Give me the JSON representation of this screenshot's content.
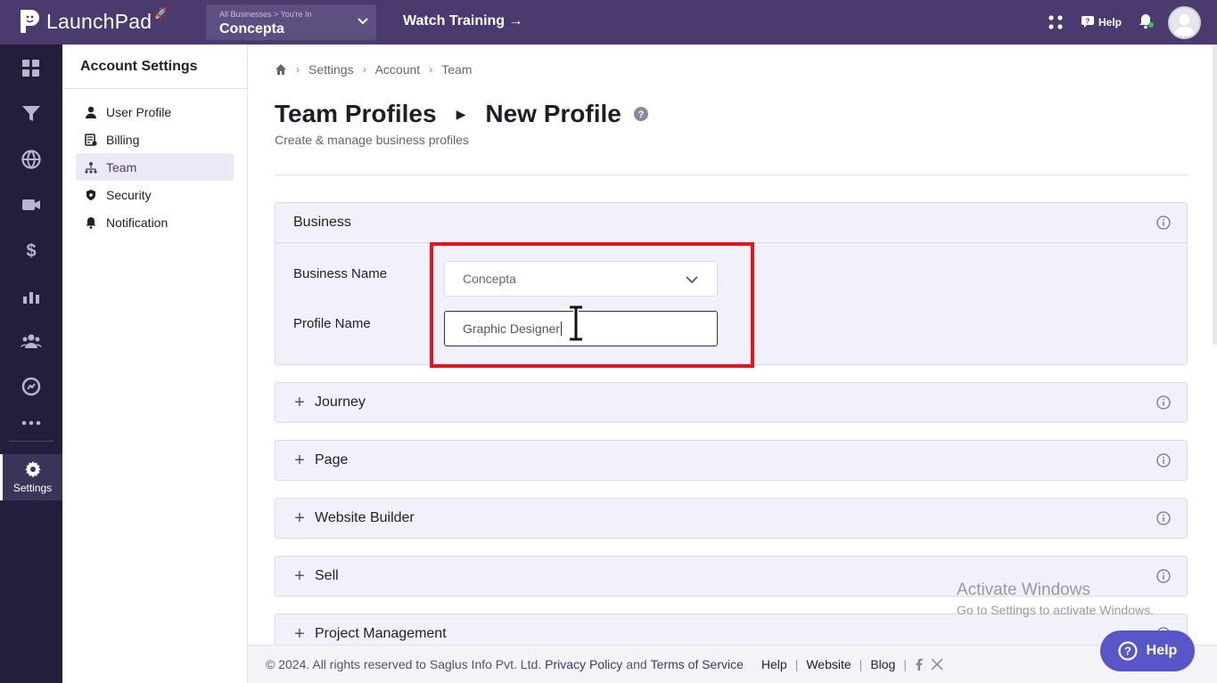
{
  "topbar": {
    "logo_text": "LaunchPad",
    "business_crumb": "All Businesses > You're In",
    "business_name": "Concepta",
    "watch_training": "Watch Training →",
    "help_label": "Help"
  },
  "rail": {
    "items": [
      "dashboard-icon",
      "funnel-icon",
      "globe-icon",
      "video-icon",
      "dollar-icon",
      "analytics-icon",
      "people-icon",
      "chart-circle-icon",
      "more-icon"
    ],
    "settings_label": "Settings"
  },
  "sidebar": {
    "title": "Account Settings",
    "items": [
      {
        "label": "User Profile",
        "icon": "user-icon"
      },
      {
        "label": "Billing",
        "icon": "billing-icon"
      },
      {
        "label": "Team",
        "icon": "team-icon",
        "active": true
      },
      {
        "label": "Security",
        "icon": "shield-icon"
      },
      {
        "label": "Notification",
        "icon": "bell-icon"
      }
    ]
  },
  "breadcrumb": {
    "items": [
      "Settings",
      "Account",
      "Team"
    ]
  },
  "page": {
    "title": "Team Profiles",
    "subtitle_title": "New Profile",
    "description": "Create & manage business profiles"
  },
  "business_panel": {
    "header": "Business",
    "business_name_label": "Business Name",
    "business_name_value": "Concepta",
    "profile_name_label": "Profile Name",
    "profile_name_value": "Graphic Designer"
  },
  "sections": [
    {
      "label": "Journey"
    },
    {
      "label": "Page"
    },
    {
      "label": "Website Builder"
    },
    {
      "label": "Sell"
    },
    {
      "label": "Project Management"
    }
  ],
  "footer": {
    "copyright": "© 2024. All rights reserved to Saglus Info Pvt. Ltd.",
    "privacy": "Privacy Policy",
    "and": "and",
    "terms": "Terms of Service",
    "help": "Help",
    "website": "Website",
    "blog": "Blog"
  },
  "watermark": {
    "line1": "Activate Windows",
    "line2": "Go to Settings to activate Windows."
  },
  "help_fab": "Help",
  "colors": {
    "topbar": "#4a3a6e",
    "rail": "#231e3b",
    "panel": "#f2f0fa",
    "highlight": "#e8141c",
    "help_fab": "#5856c8"
  }
}
